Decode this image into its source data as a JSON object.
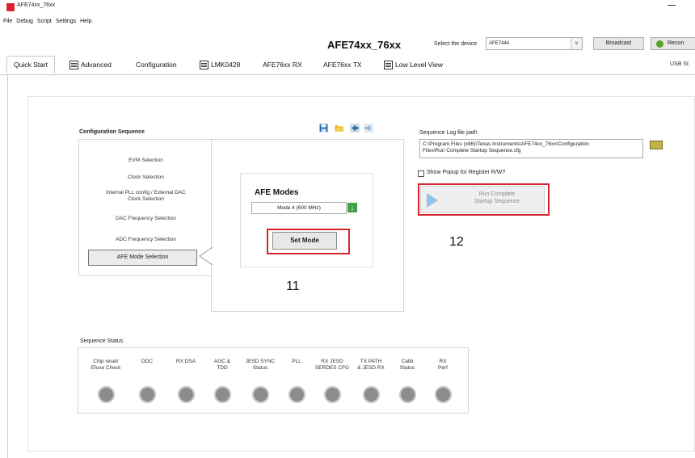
{
  "window": {
    "title": "AFE74xx_76xx"
  },
  "menu": [
    "File",
    "Debug",
    "Script",
    "Settings",
    "Help"
  ],
  "header": {
    "app_title": "AFE74xx_76xx",
    "device_label": "Select the device",
    "device_value": "AFE7444",
    "broadcast_label": "Broadcast",
    "reconnect_label": "Recon"
  },
  "tabs": [
    {
      "label": "Quick Start",
      "active": true
    },
    {
      "label": "Advanced",
      "icon": "window-icon"
    },
    {
      "label": "Configuration"
    },
    {
      "label": "LMK0428",
      "icon": "window-icon"
    },
    {
      "label": "AFE76xx RX"
    },
    {
      "label": "AFE76xx TX"
    },
    {
      "label": "Low Level View",
      "icon": "list-icon"
    }
  ],
  "usb_status": "USB St",
  "config_sequence": {
    "title": "Configuration Sequence",
    "items": [
      "EVM Selection",
      "Clock Selection",
      "Internal PLL config / External DAC Clock Selection",
      "DAC Frequency Selection",
      "ADC Frequency Selection",
      "AFE Mode Selection"
    ],
    "active_item": "AFE Mode Selection"
  },
  "afe_modes": {
    "title": "AFE Modes",
    "selected": "Mode 4 (600 MHz)",
    "set_mode_label": "Set Mode"
  },
  "annotations": {
    "step_11": "11",
    "step_12": "12"
  },
  "sequence_log": {
    "label": "Sequence Log file path",
    "path_line1": "C:\\Program Files (x86)\\Texas Instruments\\AFE74xx_76xx\\Configuration",
    "path_line2": "Files\\Run Complete Startup Sequence.cfg"
  },
  "popup_checkbox": {
    "label": "Show Popup for Register R/W?",
    "checked": false
  },
  "run_button": {
    "line1": "Run Complete",
    "line2": "Startup Sequence"
  },
  "sequence_status": {
    "title": "Sequence Status",
    "items": [
      {
        "line1": "Chip reset/",
        "line2": "Efuse Check"
      },
      {
        "line1": "DDC",
        "line2": ""
      },
      {
        "line1": "RX DSA",
        "line2": ""
      },
      {
        "line1": "AGC &",
        "line2": "TDD"
      },
      {
        "line1": "JESD SYNC",
        "line2": "Status"
      },
      {
        "line1": "PLL",
        "line2": ""
      },
      {
        "line1": "RX JESD",
        "line2": "SERDES CFG"
      },
      {
        "line1": "TX PATH",
        "line2": "& JESD RX"
      },
      {
        "line1": "Calib",
        "line2": "Status"
      },
      {
        "line1": "RX",
        "line2": "Perf"
      }
    ]
  },
  "colors": {
    "highlight": "#d9232e",
    "status_off": "#8c8c8c",
    "accept_green": "#43a047",
    "play_blue": "#8fc3ea"
  }
}
